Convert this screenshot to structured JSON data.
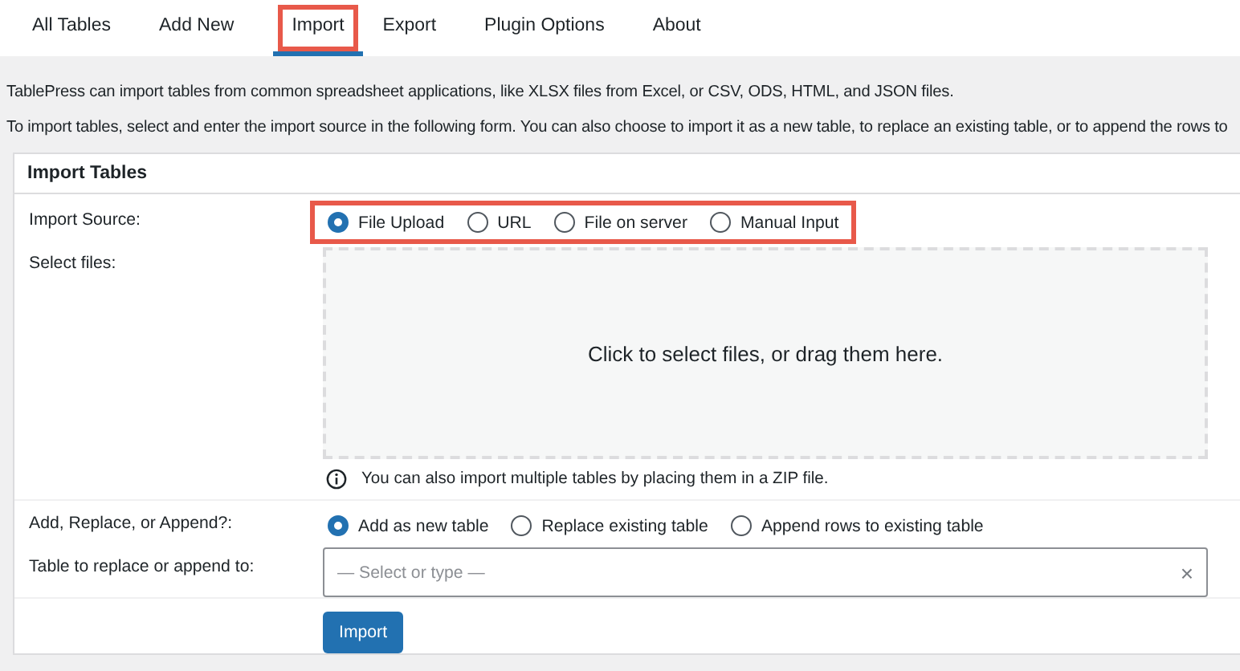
{
  "tabs": [
    {
      "label": "All Tables",
      "selected": false,
      "highlighted": false
    },
    {
      "label": "Add New",
      "selected": false,
      "highlighted": false
    },
    {
      "label": "Import",
      "selected": true,
      "highlighted": true
    },
    {
      "label": "Export",
      "selected": false,
      "highlighted": false
    },
    {
      "label": "Plugin Options",
      "selected": false,
      "highlighted": false
    },
    {
      "label": "About",
      "selected": false,
      "highlighted": false
    }
  ],
  "intro": [
    "TablePress can import tables from common spreadsheet applications, like XLSX files from Excel, or CSV, ODS, HTML, and JSON files.",
    "To import tables, select and enter the import source in the following form. You can also choose to import it as a new table, to replace an existing table, or to append the rows to"
  ],
  "panel": {
    "title": "Import Tables",
    "import_source": {
      "label": "Import Source:",
      "highlighted": true,
      "options": [
        {
          "label": "File Upload",
          "selected": true
        },
        {
          "label": "URL",
          "selected": false
        },
        {
          "label": "File on server",
          "selected": false
        },
        {
          "label": "Manual Input",
          "selected": false
        }
      ]
    },
    "select_files": {
      "label": "Select files:",
      "dropzone": "Click to select files, or drag them here.",
      "note": "You can also import multiple tables by placing them in a ZIP file."
    },
    "mode": {
      "label": "Add, Replace, or Append?:",
      "options": [
        {
          "label": "Add as new table",
          "selected": true
        },
        {
          "label": "Replace existing table",
          "selected": false
        },
        {
          "label": "Append rows to existing table",
          "selected": false
        }
      ]
    },
    "target": {
      "label": "Table to replace or append to:",
      "placeholder": "— Select or type —",
      "clear": "×"
    },
    "button": "Import"
  }
}
